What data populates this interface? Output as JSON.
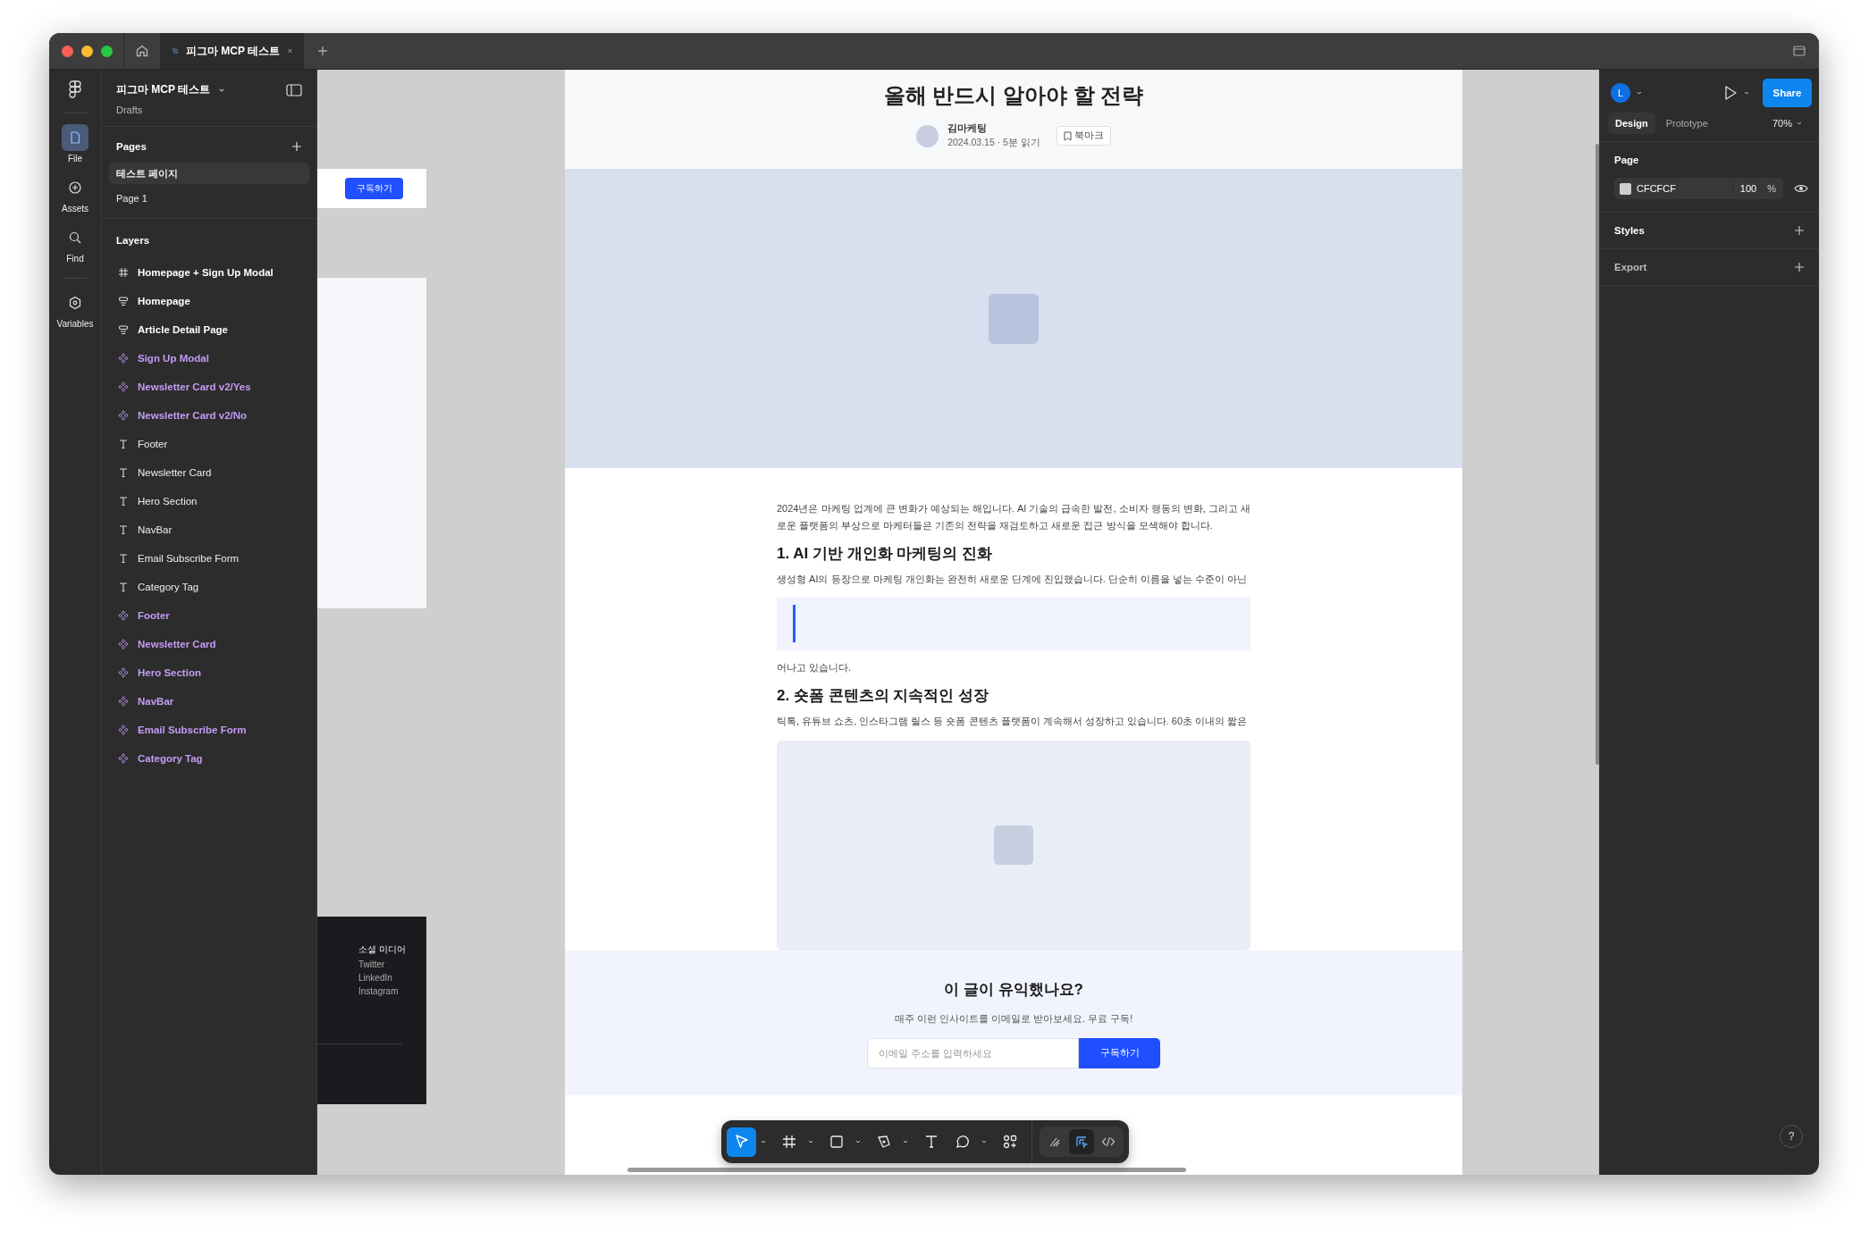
{
  "browser_tab": {
    "title": "피그마 MCP 테스트"
  },
  "rail": [
    {
      "kind": "file",
      "label": "File",
      "selected": true
    },
    {
      "kind": "assets",
      "label": "Assets",
      "selected": false
    },
    {
      "kind": "find",
      "label": "Find",
      "selected": false
    },
    {
      "kind": "variables",
      "label": "Variables",
      "selected": false
    }
  ],
  "file": {
    "name": "피그마 MCP 테스트",
    "location": "Drafts"
  },
  "pages": {
    "title": "Pages",
    "items": [
      {
        "label": "테스트 페이지",
        "selected": true
      },
      {
        "label": "Page 1",
        "selected": false
      }
    ]
  },
  "layers": {
    "title": "Layers",
    "items": [
      {
        "kind": "frame",
        "label": "Homepage + Sign Up Modal"
      },
      {
        "kind": "section",
        "label": "Homepage"
      },
      {
        "kind": "section",
        "label": "Article Detail Page"
      },
      {
        "kind": "component",
        "label": "Sign Up Modal"
      },
      {
        "kind": "component",
        "label": "Newsletter Card v2/Yes"
      },
      {
        "kind": "component",
        "label": "Newsletter Card v2/No"
      },
      {
        "kind": "text",
        "label": "Footer"
      },
      {
        "kind": "text",
        "label": "Newsletter Card"
      },
      {
        "kind": "text",
        "label": "Hero Section"
      },
      {
        "kind": "text",
        "label": "NavBar"
      },
      {
        "kind": "text",
        "label": "Email Subscribe Form"
      },
      {
        "kind": "text",
        "label": "Category Tag"
      },
      {
        "kind": "component",
        "label": "Footer"
      },
      {
        "kind": "component",
        "label": "Newsletter Card"
      },
      {
        "kind": "component",
        "label": "Hero Section"
      },
      {
        "kind": "component",
        "label": "NavBar"
      },
      {
        "kind": "component",
        "label": "Email Subscribe Form"
      },
      {
        "kind": "component",
        "label": "Category Tag"
      }
    ]
  },
  "canvas": {
    "side_button": "구독하기",
    "footer_links": [
      {
        "label": "소셜 미디어",
        "kind": "heading"
      },
      {
        "label": "Twitter",
        "kind": "link"
      },
      {
        "label": "LinkedIn",
        "kind": "link"
      },
      {
        "label": "Instagram",
        "kind": "link"
      }
    ]
  },
  "article": {
    "title": "올해 반드시 알아야 할 전략",
    "author": "김마케팅",
    "meta": "2024.03.15 · 5분 읽기",
    "bookmark": "북마크",
    "body": [
      {
        "kind": "paragraph",
        "text": "2024년은 마케팅 업계에 큰 변화가 예상되는 해입니다. AI 기술의 급속한 발전, 소비자 행동의 변화, 그리고 새로운 플랫폼의 부상으로 마케터들은 기존의 전략을 재검토하고 새로운 접근 방식을 모색해야 합니다."
      },
      {
        "kind": "heading",
        "text": "1. AI 기반 개인화 마케팅의 진화"
      },
      {
        "kind": "paragraph",
        "text": "생성형 AI의 등장으로 마케팅 개인화는 완전히 새로운 단계에 진입했습니다. 단순히 이름을 넣는 수준이 아닌"
      },
      {
        "kind": "quote"
      },
      {
        "kind": "paragraph",
        "text": "어나고 있습니다."
      },
      {
        "kind": "heading",
        "text": "2. 숏폼 콘텐츠의 지속적인 성장"
      },
      {
        "kind": "paragraph",
        "text": "틱톡, 유튜브 쇼츠, 인스타그램 릴스 등 숏폼 콘텐츠 플랫폼이 계속해서 성장하고 있습니다. 60초 이내의 짧은"
      },
      {
        "kind": "image"
      }
    ],
    "newsletter": {
      "title": "이 글이 유익했나요?",
      "subtitle": "매주 이런 인사이트를 이메일로 받아보세요. 무료 구독!",
      "placeholder": "이메일 주소를 입력하세요",
      "button": "구독하기"
    }
  },
  "toolbar": [
    {
      "kind": "move",
      "selected": true,
      "menu": true
    },
    {
      "kind": "frame",
      "selected": false,
      "menu": true
    },
    {
      "kind": "rectangle",
      "selected": false,
      "menu": true
    },
    {
      "kind": "pen",
      "selected": false,
      "menu": true
    },
    {
      "kind": "text",
      "selected": false,
      "menu": false
    },
    {
      "kind": "comment",
      "selected": false,
      "menu": true
    },
    {
      "kind": "actions",
      "selected": false,
      "menu": false
    }
  ],
  "modes": [
    {
      "kind": "draw",
      "selected": false
    },
    {
      "kind": "design",
      "selected": true
    },
    {
      "kind": "dev",
      "selected": false
    }
  ],
  "inspector": {
    "avatar": "L",
    "share": "Share",
    "tabs": [
      {
        "label": "Design",
        "selected": true
      },
      {
        "label": "Prototype",
        "selected": false
      }
    ],
    "zoom": "70%",
    "page_title": "Page",
    "page_color": {
      "hex": "CFCFCF",
      "color": "#cfcfcf",
      "opacity": "100",
      "unit": "%"
    },
    "styles": "Styles",
    "export": "Export"
  },
  "help": "?"
}
